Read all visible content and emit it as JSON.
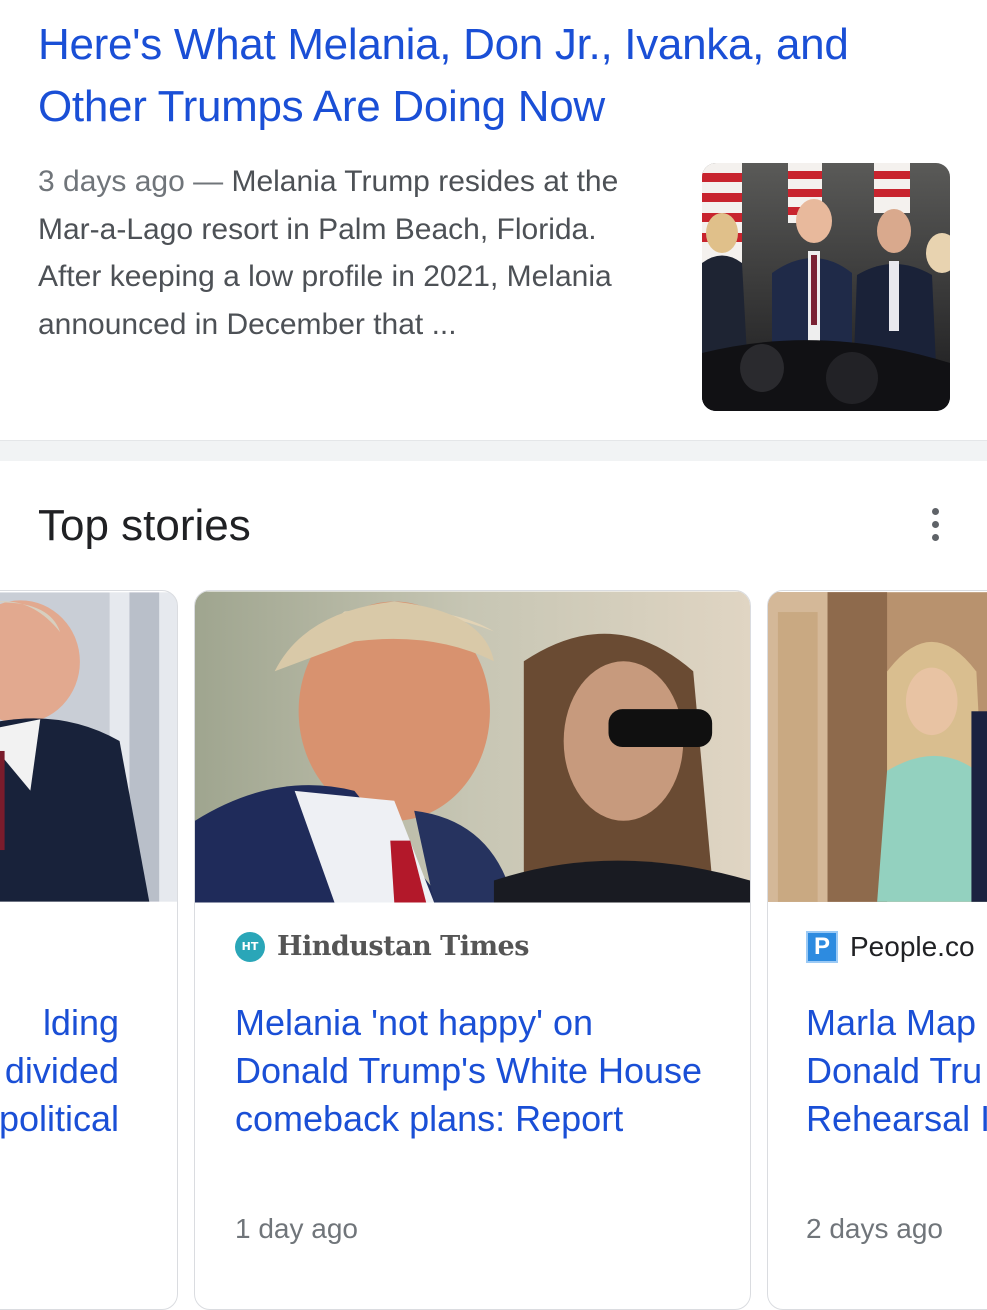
{
  "result": {
    "title": "Here's What Melania, Don Jr., Ivanka, and Other Trumps Are Doing Now",
    "date": "3 days ago",
    "separator": " — ",
    "snippet": "Melania Trump resides at the Mar-a-Lago resort in Palm Beach, Florida. After keeping a low profile in 2021, Melania announced in December that ..."
  },
  "top_stories": {
    "title": "Top stories",
    "more_icon": "more-vert-icon",
    "cards": [
      {
        "headline_partial": [
          "lding",
          "divided",
          "political"
        ]
      },
      {
        "source_logo": "HT",
        "source": "Hindustan Times",
        "headline": "Melania 'not happy' on Donald Trump's White House comeback plans: Report",
        "time": "1 day ago"
      },
      {
        "source_logo": "P",
        "source": "People.co",
        "headline_partial": [
          "Marla Map",
          "Donald Tru",
          "Rehearsal I"
        ],
        "time": "2 days ago"
      }
    ]
  },
  "colors": {
    "link": "#1a4fd6",
    "snippet": "#4d5156",
    "meta": "#70757a",
    "divider": "#f1f3f4"
  }
}
